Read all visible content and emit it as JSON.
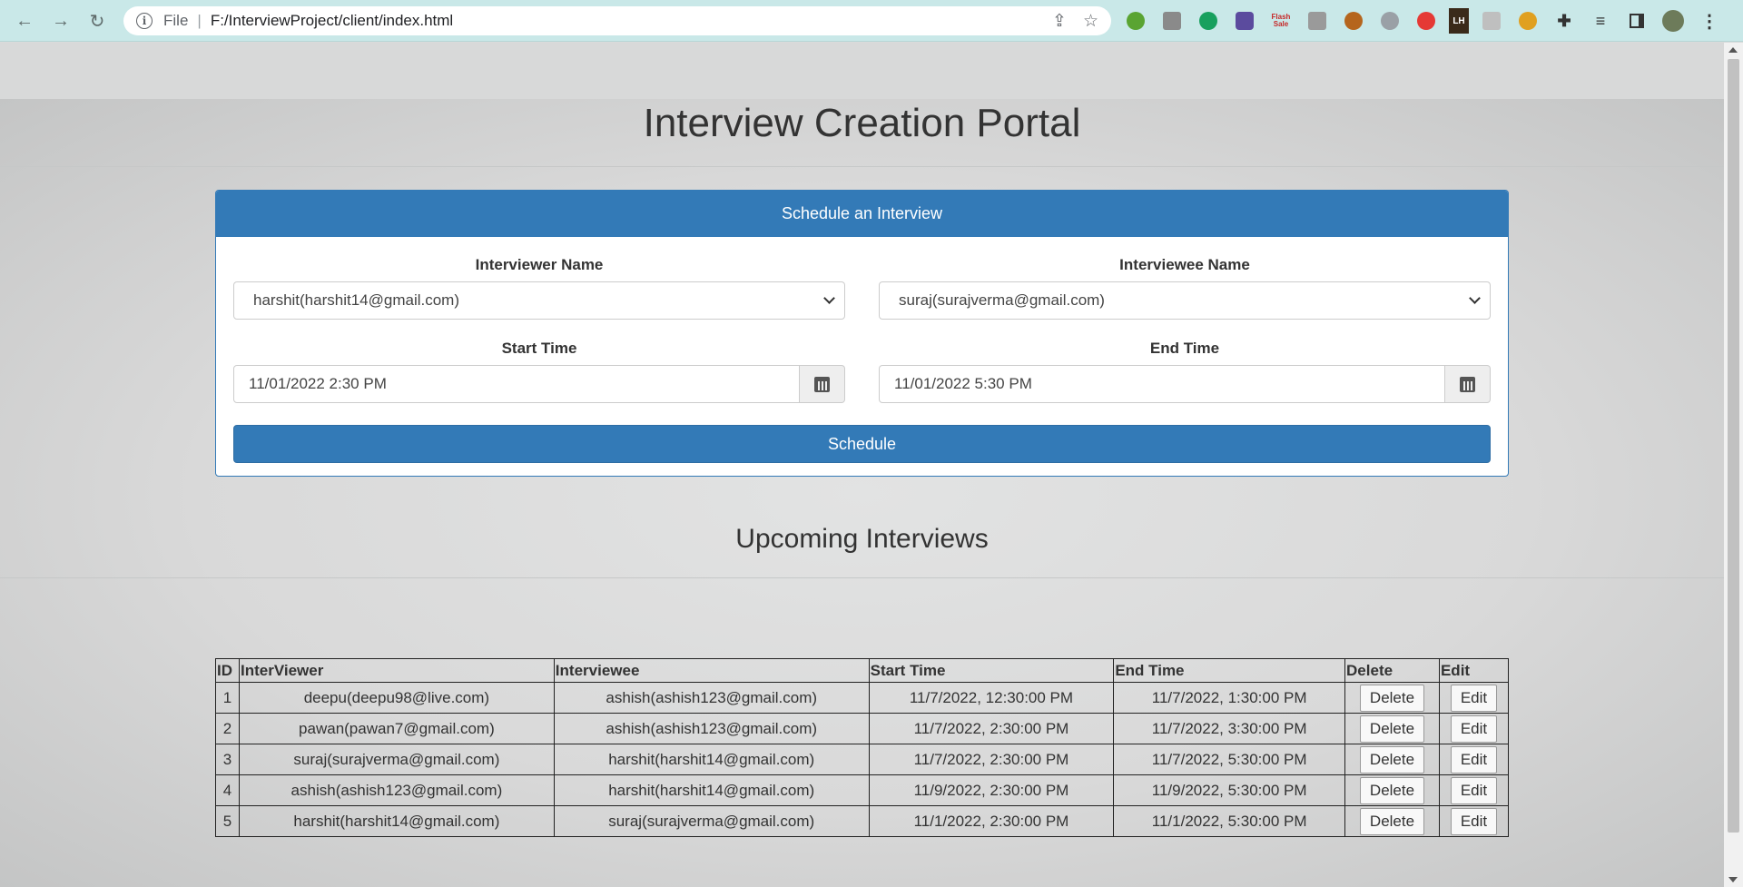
{
  "browser": {
    "url_scheme": "File",
    "url": "F:/InterviewProject/client/index.html",
    "extensions": [
      "#5aa432",
      "#8a8a8a",
      "#18a05e",
      "#5b4b9e",
      "Flash Sale",
      "#9a9a9a",
      "#b5651d",
      "#9aa0a6",
      "#e53935",
      "LH",
      "#bfbfbf",
      "#e0a020",
      "#333333",
      "#444444",
      "#333333"
    ]
  },
  "page": {
    "title": "Interview Creation Portal",
    "subtitle": "Upcoming Interviews"
  },
  "form": {
    "heading": "Schedule an Interview",
    "interviewer_label": "Interviewer Name",
    "interviewer_value": "harshit(harshit14@gmail.com)",
    "interviewee_label": "Interviewee Name",
    "interviewee_value": "suraj(surajverma@gmail.com)",
    "start_label": "Start Time",
    "start_value": "11/01/2022 2:30 PM",
    "end_label": "End Time",
    "end_value": "11/01/2022 5:30 PM",
    "schedule_button": "Schedule"
  },
  "table": {
    "headers": [
      "ID",
      "InterViewer",
      "Interviewee",
      "Start Time",
      "End Time",
      "Delete",
      "Edit"
    ],
    "rows": [
      {
        "id": "1",
        "interviewer": "deepu(deepu98@live.com)",
        "interviewee": "ashish(ashish123@gmail.com)",
        "start": "11/7/2022, 12:30:00 PM",
        "end": "11/7/2022, 1:30:00 PM",
        "delete": "Delete",
        "edit": "Edit"
      },
      {
        "id": "2",
        "interviewer": "pawan(pawan7@gmail.com)",
        "interviewee": "ashish(ashish123@gmail.com)",
        "start": "11/7/2022, 2:30:00 PM",
        "end": "11/7/2022, 3:30:00 PM",
        "delete": "Delete",
        "edit": "Edit"
      },
      {
        "id": "3",
        "interviewer": "suraj(surajverma@gmail.com)",
        "interviewee": "harshit(harshit14@gmail.com)",
        "start": "11/7/2022, 2:30:00 PM",
        "end": "11/7/2022, 5:30:00 PM",
        "delete": "Delete",
        "edit": "Edit"
      },
      {
        "id": "4",
        "interviewer": "ashish(ashish123@gmail.com)",
        "interviewee": "harshit(harshit14@gmail.com)",
        "start": "11/9/2022, 2:30:00 PM",
        "end": "11/9/2022, 5:30:00 PM",
        "delete": "Delete",
        "edit": "Edit"
      },
      {
        "id": "5",
        "interviewer": "harshit(harshit14@gmail.com)",
        "interviewee": "suraj(surajverma@gmail.com)",
        "start": "11/1/2022, 2:30:00 PM",
        "end": "11/1/2022, 5:30:00 PM",
        "delete": "Delete",
        "edit": "Edit"
      }
    ]
  }
}
